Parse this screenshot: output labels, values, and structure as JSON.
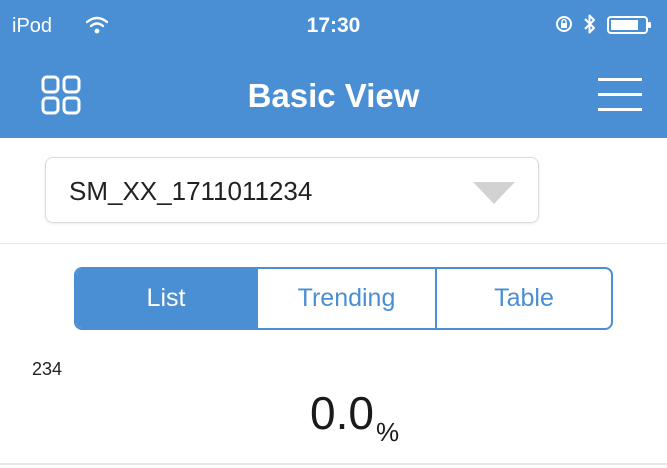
{
  "status_bar": {
    "carrier": "iPod",
    "time": "17:30",
    "icons": [
      "wifi-icon",
      "rotation-lock-icon",
      "bluetooth-icon",
      "battery-icon"
    ]
  },
  "nav_bar": {
    "title": "Basic View",
    "left_icon": "grid-icon",
    "right_icon": "hamburger-menu-icon"
  },
  "device_select": {
    "value": "SM_XX_1711011234",
    "icon": "dropdown-arrow-icon"
  },
  "tabs": [
    {
      "label": "List",
      "active": true
    },
    {
      "label": "Trending",
      "active": false
    },
    {
      "label": "Table",
      "active": false
    }
  ],
  "reading": {
    "id": "234",
    "value": "0.0",
    "unit": "%"
  },
  "colors": {
    "accent": "#4a8fd3",
    "text": "#222222",
    "divider": "#e8e8e8"
  }
}
